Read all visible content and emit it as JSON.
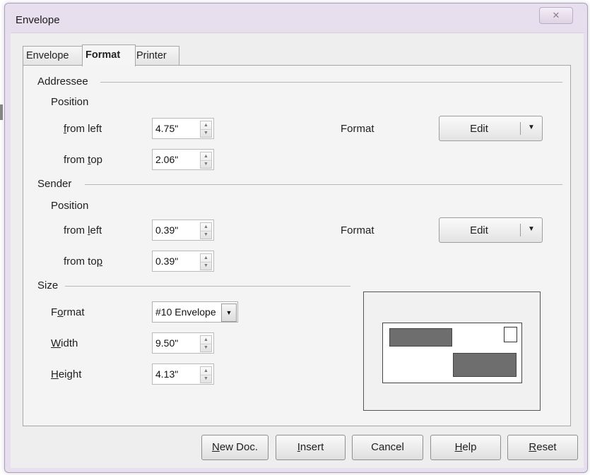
{
  "window": {
    "title": "Envelope",
    "close_glyph": "⊠"
  },
  "tabs": [
    {
      "label": "Envelope",
      "active": false
    },
    {
      "label": "Format",
      "active": true
    },
    {
      "label": "Printer",
      "active": false
    }
  ],
  "addressee": {
    "section_label": "Addressee",
    "position_label": "Position",
    "left_label_pre": "",
    "left_label_key": "f",
    "left_label_post": "rom left",
    "top_label_pre": "from ",
    "top_label_key": "t",
    "top_label_post": "op",
    "from_left_value": "4.75\"",
    "from_top_value": "2.06\"",
    "format_label": "Format",
    "edit_label": "Edit"
  },
  "sender": {
    "section_label": "Sender",
    "position_label": "Position",
    "left_label_pre": "from ",
    "left_label_key": "l",
    "left_label_post": "eft",
    "top_label_pre": "from to",
    "top_label_key": "p",
    "top_label_post": "",
    "from_left_value": "0.39\"",
    "from_top_value": "0.39\"",
    "format_label": "Format",
    "edit_label": "Edit"
  },
  "size": {
    "section_label": "Size",
    "format_label_pre": "F",
    "format_label_key": "o",
    "format_label_post": "rmat",
    "format_value": "#10 Envelope",
    "width_label_key": "W",
    "width_label_post": "idth",
    "width_value": "9.50\"",
    "height_label_key": "H",
    "height_label_post": "eight",
    "height_value": "4.13\""
  },
  "buttons": {
    "new_doc": {
      "key": "N",
      "rest": "ew Doc."
    },
    "insert": {
      "key": "I",
      "rest": "nsert"
    },
    "cancel": {
      "label": "Cancel"
    },
    "help": {
      "key": "H",
      "rest": "elp"
    },
    "reset": {
      "key": "R",
      "rest": "eset"
    }
  },
  "icons": {
    "spin_up": "▲",
    "spin_down": "▼",
    "dropdown": "▼"
  },
  "colors": {
    "frame": "#e8dfee",
    "panel": "#f4f4f4",
    "preview_block": "#6e6e6e"
  }
}
